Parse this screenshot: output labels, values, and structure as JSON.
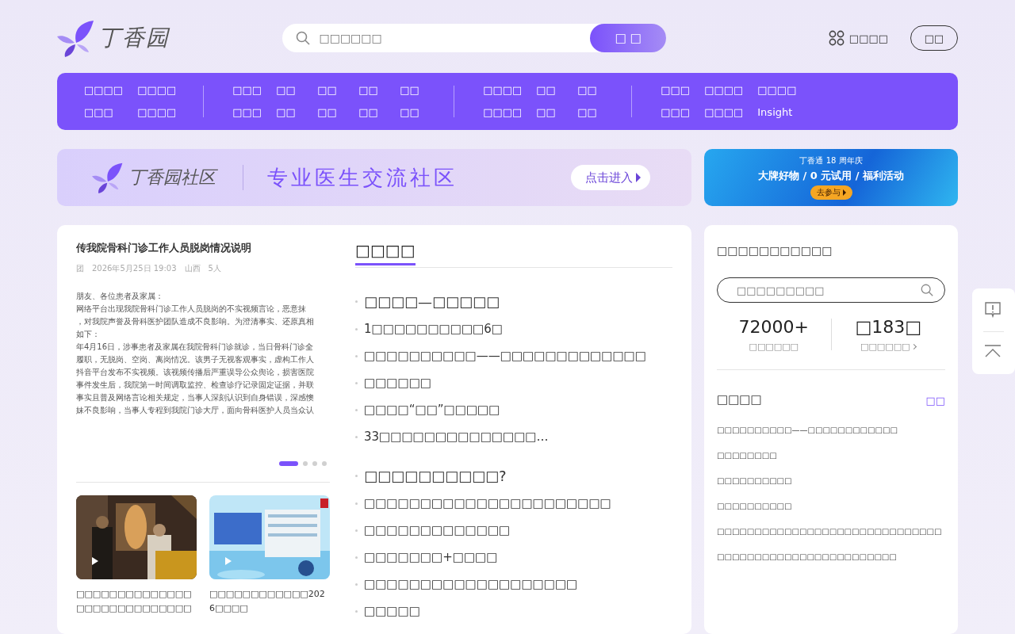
{
  "header": {
    "logo": "丁香园",
    "search": {
      "placeholder": "□□□□□□"
    },
    "search_button": "□ □",
    "apps": "□□□□",
    "login": "□□"
  },
  "nav": [
    {
      "columns": [
        [
          "□□□□",
          "□□□"
        ],
        [
          "□□□□",
          "□□□□"
        ]
      ]
    },
    {
      "columns": [
        [
          "□□□",
          "□□□"
        ],
        [
          "□□",
          "□□"
        ],
        [
          "□□",
          "□□"
        ],
        [
          "□□",
          "□□"
        ],
        [
          "□□",
          "□□"
        ]
      ]
    },
    {
      "columns": [
        [
          "□□□□",
          "□□□□"
        ],
        [
          "□□",
          "□□"
        ],
        [
          "□□",
          "□□"
        ]
      ]
    },
    {
      "columns": [
        [
          "□□□",
          "□□□"
        ],
        [
          "□□□□",
          "□□□□"
        ],
        [
          "□□□□",
          "Insight"
        ]
      ]
    }
  ],
  "banner": {
    "logo": "丁香园社区",
    "slogan": "专业医生交流社区",
    "button": "点击进入"
  },
  "ad": {
    "brand": "丁香通 18 周年庆",
    "headline": "大牌好物 / 0 元试用 / 福利活动",
    "button": "去参与"
  },
  "slide": {
    "title": "传我院骨科门诊工作人员脱岗情况说明",
    "meta": [
      "团",
      "2026年5月25日 19:03",
      "山西",
      "5人"
    ],
    "lines": [
      "朋友、各位患者及家属：",
      "网络平台出现我院骨科门诊工作人员脱岗的不实视频言论，恶意抹",
      "，对我院声誉及骨科医护团队造成不良影响。为澄清事实、还原真相",
      "如下：",
      "年4月16日，涉事患者及家属在我院骨科门诊就诊，当日骨科门诊全",
      "履职，无脱岗、空岗、离岗情况。该男子无视客观事实，虚构工作人",
      "抖音平台发布不实视频。该视频传播后严重误导公众舆论，损害医院",
      "事件发生后，我院第一时间调取监控、检查诊疗记录固定证据，并联",
      "事实且普及网络言论相关规定，当事人深刻认识到自身错误，深感懊",
      "妹不良影响，当事人专程到我院门诊大厅，面向骨科医护人员当众认"
    ]
  },
  "slides": [
    {
      "selected": true
    },
    {
      "selected": false
    },
    {
      "selected": false
    },
    {
      "selected": false
    }
  ],
  "videos": [
    {
      "kind": "picture",
      "caption": "□□□□□□□□□□□□□□□□□□□□□□□□□□□□"
    },
    {
      "kind": "picture",
      "caption": "□□□□□□□□□□□□2026□□□□"
    }
  ],
  "news": {
    "title": "□□□□",
    "items": [
      {
        "text": "□□□□—□□□□□",
        "headline": true
      },
      {
        "text": "1□□□□□□□□□□6□",
        "headline": false
      },
      {
        "text": "□□□□□□□□□□——□□□□□□□□□□□□□",
        "headline": false
      },
      {
        "text": "□□□□□□",
        "headline": false
      },
      {
        "text": "□□□□“□□”□□□□□",
        "headline": false
      },
      {
        "text": "33□□□□□□□□□□□□□□…",
        "headline": false
      },
      {
        "text": "□□□□□□□□□□?",
        "headline": true
      },
      {
        "text": "□□□□□□□□□□□□□□□□□□□□□□",
        "headline": false
      },
      {
        "text": "□□□□□□□□□□□□□",
        "headline": false
      },
      {
        "text": "□□□□□□□+□□□□",
        "headline": false
      },
      {
        "text": "□□□□□□□□□□□□□□□□□□□",
        "headline": false
      },
      {
        "text": "□□□□□",
        "headline": false
      }
    ]
  },
  "side": {
    "title": "□□□□□□□□□□□",
    "search": {
      "placeholder": "□□□□□□□□□"
    },
    "stats": [
      {
        "value": "72000+",
        "label": "□□□□□□",
        "link": false
      },
      {
        "value": "□183□",
        "label": "□□□□□□",
        "link": true
      }
    ],
    "list_title": "□□□□",
    "more": "□□",
    "list": [
      "□□□□□□□□□□——□□□□□□□□□□□□",
      "□□□□□□□□",
      "□□□□□□□□□□",
      "□□□□□□□□□□",
      "□□□□□□□□□□□□□□□□□□□□□□□□□□□□□□",
      "□□□□□□□□□□□□□□□□□□□□□□□□"
    ]
  }
}
